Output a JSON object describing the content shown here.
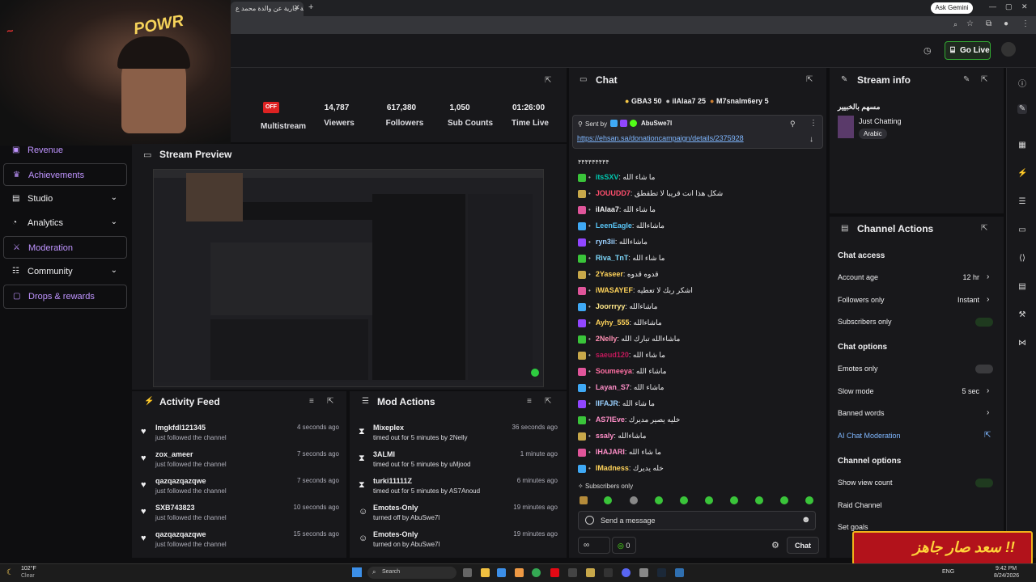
{
  "browser": {
    "tab_title": "صدقة جارية عن والدة محمد ع",
    "ask_label": "Ask Gemini"
  },
  "header": {
    "go_live_label": "Go Live"
  },
  "webcam": {
    "logo_text": "POWR"
  },
  "sidebar": {
    "items": [
      {
        "label": "Revenue",
        "icon": "revenue-icon",
        "expandable": false
      },
      {
        "label": "Achievements",
        "icon": "trophy-icon",
        "expandable": false
      },
      {
        "label": "Studio",
        "icon": "studio-icon",
        "expandable": true
      },
      {
        "label": "Analytics",
        "icon": "analytics-icon",
        "expandable": true
      },
      {
        "label": "Moderation",
        "icon": "sword-icon",
        "expandable": false
      },
      {
        "label": "Community",
        "icon": "community-icon",
        "expandable": true
      },
      {
        "label": "Drops & rewards",
        "icon": "gift-icon",
        "expandable": false
      }
    ]
  },
  "stats": {
    "multistream_badge": "OFF",
    "multistream_label": "Multistream",
    "viewers_value": "14,787",
    "viewers_label": "Viewers",
    "followers_value": "617,380",
    "followers_label": "Followers",
    "subs_value": "1,050",
    "subs_label": "Sub Counts",
    "time_value": "01:26:00",
    "time_label": "Time Live"
  },
  "preview": {
    "title": "Stream Preview"
  },
  "activity_feed": {
    "title": "Activity Feed",
    "items": [
      {
        "name": "Imgkfdl121345",
        "action": "just followed the channel",
        "time": "4 seconds ago"
      },
      {
        "name": "zox_ameer",
        "action": "just followed the channel",
        "time": "7 seconds ago"
      },
      {
        "name": "qazqazqazqwe",
        "action": "just followed the channel",
        "time": "7 seconds ago"
      },
      {
        "name": "SXB743823",
        "action": "just followed the channel",
        "time": "10 seconds ago"
      },
      {
        "name": "qazqazqazqwe",
        "action": "just followed the channel",
        "time": "15 seconds ago"
      }
    ]
  },
  "mod_actions": {
    "title": "Mod Actions",
    "items": [
      {
        "name": "Mixeplex",
        "action": "timed out for 5 minutes by 2Nelly",
        "time": "36 seconds ago",
        "icon": "hourglass-icon"
      },
      {
        "name": "3ALMI",
        "action": "timed out for 5 minutes by uMjood",
        "time": "1 minute ago",
        "icon": "hourglass-icon"
      },
      {
        "name": "turki11111Z",
        "action": "timed out for 5 minutes by AS7Anoud",
        "time": "6 minutes ago",
        "icon": "hourglass-icon"
      },
      {
        "name": "Emotes-Only",
        "action": "turned off by AbuSwe7l",
        "time": "19 minutes ago",
        "icon": "smile-icon"
      },
      {
        "name": "Emotes-Only",
        "action": "turned on by AbuSwe7l",
        "time": "19 minutes ago",
        "icon": "smile-icon"
      }
    ]
  },
  "chat": {
    "title": "Chat",
    "leaderboard": [
      {
        "name": "GBA3",
        "count": "50"
      },
      {
        "name": "ilAlaa7",
        "count": "25"
      },
      {
        "name": "M7snalm6ery",
        "count": "5"
      }
    ],
    "pinned_sent_by_label": "Sent by",
    "pinned_sender": "AbuSwe7l",
    "pinned_link": "https://ehsan.sa/donationcampaign/details/2375928",
    "top_fragment": "۴۴۴۴۴۴۴۴۴",
    "messages": [
      {
        "user": "itsSXV",
        "text": "ما شاء الله",
        "color": "#00c8af"
      },
      {
        "user": "JOUUDD7",
        "text": "شكل هذا انت قريبا لا تطقطق",
        "color": "#ff4f6d"
      },
      {
        "user": "ilAlaa7",
        "text": "ما شاء الله",
        "color": "#efeff1"
      },
      {
        "user": "LeenEagle",
        "text": "ماشاءالله",
        "color": "#5ac8fa"
      },
      {
        "user": "ryn3ii",
        "text": "ماشاءالله",
        "color": "#9ad0ff"
      },
      {
        "user": "Riva_TnT",
        "text": "ما شاء الله",
        "color": "#7fdbff"
      },
      {
        "user": "2Yaseer",
        "text": "قدوه قدوه",
        "color": "#ffd35a"
      },
      {
        "user": "iWASAYEF",
        "text": "اشكر ربك لا تعطيه",
        "color": "#ffd35a"
      },
      {
        "user": "Joorrryy",
        "text": "ماشاءالله",
        "color": "#ffe88a"
      },
      {
        "user": "Ayhy_555",
        "text": "ماشاءالله",
        "color": "#ffd35a"
      },
      {
        "user": "2Nelly",
        "text": "ماشاءالله تبارك الله",
        "color": "#ff8fb3"
      },
      {
        "user": "saeud120",
        "text": "ما شاء الله",
        "color": "#c2185b"
      },
      {
        "user": "Soumeeya",
        "text": "ماشاء الله",
        "color": "#ff6fa3"
      },
      {
        "user": "Layan_S7",
        "text": "ماشاء الله",
        "color": "#ff8fc8"
      },
      {
        "user": "IIFAJR",
        "text": "ما شاء الله",
        "color": "#9ad0ff"
      },
      {
        "user": "AS7IEve",
        "text": "خليه يصير مديرك",
        "color": "#ff8fc8"
      },
      {
        "user": "ssaly",
        "text": "ماشاءالله",
        "color": "#ff8fc8"
      },
      {
        "user": "IHAJARI",
        "text": "ما شاء الله",
        "color": "#ff8fc8"
      },
      {
        "user": "IMadness",
        "text": "خله يديرك",
        "color": "#ffd35a"
      }
    ],
    "subscribers_only_label": "Subscribers only",
    "input_placeholder": "Send a message",
    "points_value": "0",
    "send_label": "Chat"
  },
  "stream_info": {
    "title": "Stream info",
    "stream_title": "مسهم بالخبيير",
    "category": "Just Chatting",
    "language_tag": "Arabic"
  },
  "channel_actions": {
    "title": "Channel Actions",
    "chat_access_heading": "Chat access",
    "account_age_label": "Account age",
    "account_age_value": "12 hr",
    "followers_only_label": "Followers only",
    "followers_only_value": "Instant",
    "subscribers_only_label": "Subscribers only",
    "chat_options_heading": "Chat options",
    "emotes_only_label": "Emotes only",
    "slow_mode_label": "Slow mode",
    "slow_mode_value": "5 sec",
    "banned_words_label": "Banned words",
    "ai_moderation_label": "AI Chat Moderation",
    "channel_options_heading": "Channel options",
    "show_view_count_label": "Show view count",
    "raid_channel_label": "Raid Channel",
    "set_goals_label": "Set goals"
  },
  "overlay": {
    "banner_text": "سعد صار جاهز !!"
  },
  "taskbar": {
    "weather_temp": "102°F",
    "weather_desc": "Clear",
    "search_placeholder": "Search",
    "lang": "ENG",
    "time": "9:42 PM",
    "date": "8/24/2026"
  },
  "colors": {
    "accent_green": "#53fc18",
    "panel_bg": "#18181b",
    "page_bg": "#0e0e10"
  }
}
